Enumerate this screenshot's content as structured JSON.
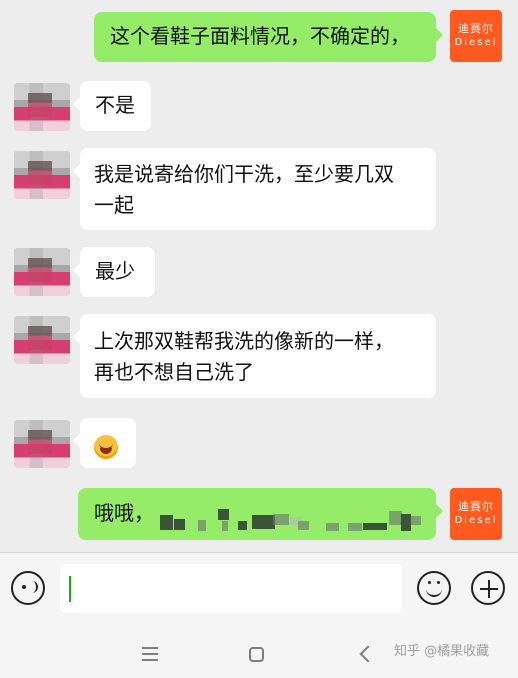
{
  "messages": [
    {
      "side": "right",
      "text": "这个看鞋子面料情况，不确定的，",
      "avatar": {
        "cn": "迪赛尔",
        "en": "Diesel"
      }
    },
    {
      "side": "left",
      "text": "不是"
    },
    {
      "side": "left",
      "line1": "我是说寄给你们干洗，至少要几双",
      "line2": "一起"
    },
    {
      "side": "left",
      "text": "最少"
    },
    {
      "side": "left",
      "line1": "上次那双鞋帮我洗的像新的一样，",
      "line2": "再也不想自己洗了"
    },
    {
      "side": "left",
      "emoji": "laughing-emoji"
    },
    {
      "side": "right",
      "text": "哦哦，",
      "avatar": {
        "cn": "迪赛尔",
        "en": "Diesel"
      },
      "redacted": true
    }
  ],
  "input_bar": {
    "voice_icon": "voice-icon",
    "emoji_icon": "smile-icon",
    "plus_icon": "plus-icon"
  },
  "navbar": {
    "menu_icon": "menu-icon",
    "home_icon": "home-icon",
    "back_icon": "back-icon",
    "watermark": "知乎 @橘果收藏"
  },
  "colors": {
    "chat_bg": "#ededed",
    "right_bubble": "#95ec69",
    "left_bubble": "#ffffff",
    "brand": "#ff5a1f",
    "cursor": "#1aad19"
  }
}
